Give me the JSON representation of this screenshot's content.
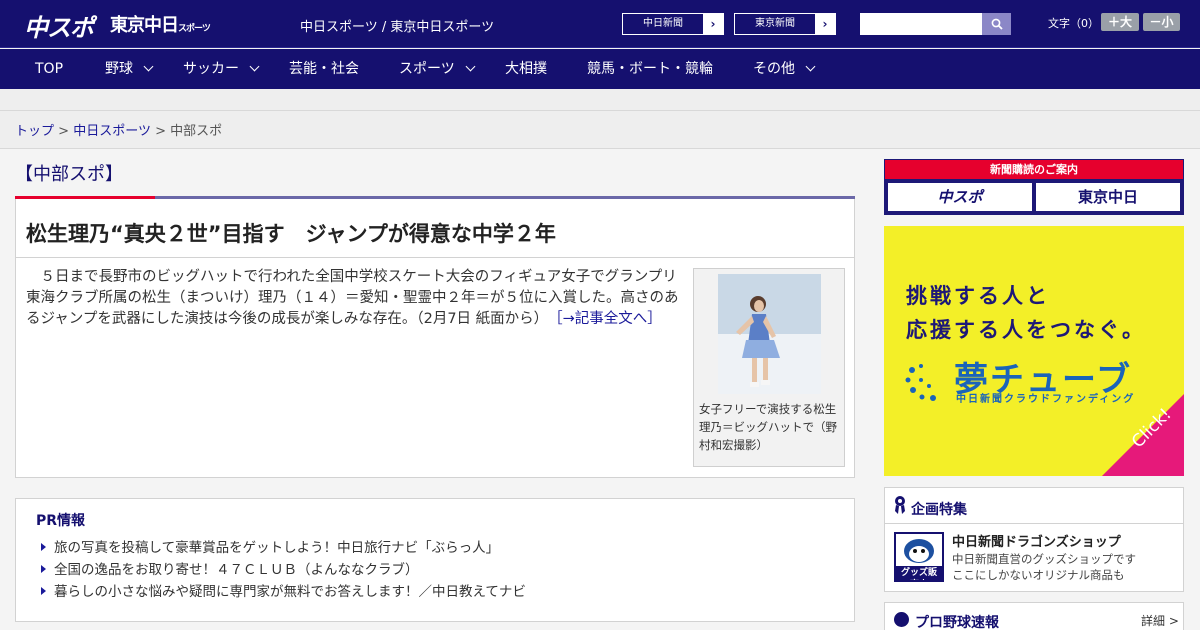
{
  "header": {
    "logo_chuspo": "中スポ",
    "logo_tokyo": "東京中日",
    "logo_tokyo_small": "スポーツ",
    "site_title": "中日スポーツ / 東京中日スポーツ",
    "link_chunichi": "中日新聞",
    "link_tokyo": "東京新聞",
    "search_placeholder": "",
    "font_size_label": "文字（0）",
    "font_larger": "＋大",
    "font_smaller": "－小",
    "brand_color": "#15106f"
  },
  "nav": {
    "items": [
      {
        "label": "TOP",
        "has_menu": false
      },
      {
        "label": "野球",
        "has_menu": true
      },
      {
        "label": "サッカー",
        "has_menu": true
      },
      {
        "label": "芸能・社会",
        "has_menu": false
      },
      {
        "label": "スポーツ",
        "has_menu": true
      },
      {
        "label": "大相撲",
        "has_menu": false
      },
      {
        "label": "競馬・ボート・競輪",
        "has_menu": false
      },
      {
        "label": "その他",
        "has_menu": true
      }
    ]
  },
  "breadcrumb": {
    "top": "トップ",
    "sep": ">",
    "parent": "中日スポーツ",
    "current": "中部スポ"
  },
  "section": {
    "title": "【中部スポ】"
  },
  "article": {
    "headline": "松生理乃“真央２世”目指す　ジャンプが得意な中学２年",
    "body": "　５日まで長野市のビッグハットで行われた全国中学校スケート大会のフィギュア女子でグランプリ東海クラブ所属の松生（まついけ）理乃（１４）＝愛知・聖霊中２年＝が５位に入賞した。高さのあるジャンプを武器にした演技は今後の成長が楽しみな存在。（2月7日 紙面から）",
    "more_link": "［→記事全文へ］",
    "photo_caption": "女子フリーで演技する松生理乃＝ビッグハットで（野村和宏撮影）"
  },
  "pr": {
    "title": "PR情報",
    "items": [
      "旅の写真を投稿して豪華賞品をゲットしよう！中日旅行ナビ「ぶらっ人」",
      "全国の逸品をお取り寄せ！４７ＣＬＵＢ（よんななクラブ）",
      "暮らしの小さな悩みや疑問に専門家が無料でお答えします！／中日教えてナビ"
    ]
  },
  "sidebar": {
    "subscribe_strip": "新聞購読のご案内",
    "subscribe_logo_a": "中スポ",
    "subscribe_logo_b": "東京中日",
    "ad": {
      "line1": "挑戦する人と",
      "line2": "応援する人をつなぐ。",
      "brand": "夢チューブ",
      "sub": "中日新聞クラウドファンディング",
      "click": "Click!",
      "bg_color": "#f3ef28",
      "accent_color": "#e6197a"
    },
    "feature": {
      "title": "企画特集",
      "thumb_label": "グッズ販売中",
      "name": "中日新聞ドラゴンズショップ",
      "desc_line1": "中日新聞直営のグッズショップです",
      "desc_line2": "ここにしかないオリジナル商品も"
    },
    "baseball": {
      "title": "プロ野球速報",
      "detail": "詳細 >"
    }
  }
}
